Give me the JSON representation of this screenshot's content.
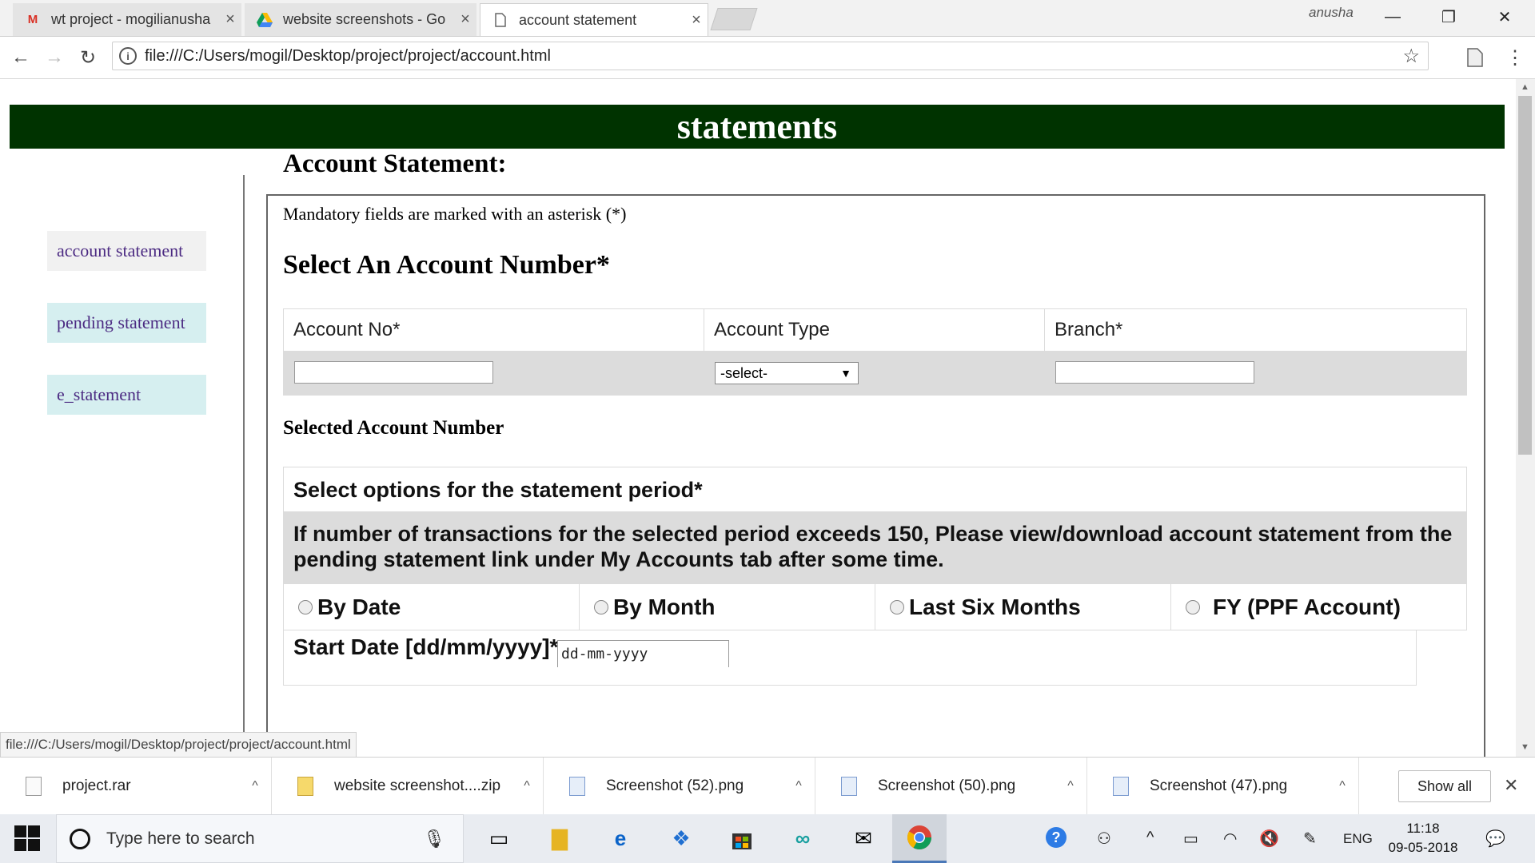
{
  "browser": {
    "tabs": [
      {
        "title": "wt project - mogilianusha",
        "icon": "gmail-icon"
      },
      {
        "title": "website screenshots - Go",
        "icon": "drive-icon"
      },
      {
        "title": "account statement",
        "icon": "document-icon"
      }
    ],
    "profile_name": "anusha",
    "url": "file:///C:/Users/mogil/Desktop/project/project/account.html",
    "status_url": "file:///C:/Users/mogil/Desktop/project/project/account.html"
  },
  "page": {
    "banner_title": "statements",
    "sidebar": [
      {
        "label": "account statement",
        "bg": "#f1f1f1"
      },
      {
        "label": "pending statement",
        "bg": "#d6eff0"
      },
      {
        "label": "e_statement",
        "bg": "#d6eff0"
      }
    ],
    "heading": "Account Statement:",
    "mandatory_note": "Mandatory fields are marked with an asterisk (*)",
    "select_heading": "Select An Account Number*",
    "account_table": {
      "headers": [
        "Account No*",
        "Account Type",
        "Branch*"
      ],
      "account_no_value": "",
      "account_type_selected": "-select-",
      "branch_value": ""
    },
    "selected_heading": "Selected Account Number",
    "period": {
      "heading": "Select options for the statement period*",
      "warning": "If number of transactions for the selected period exceeds 150, Please view/download account statement from the pending statement link under My Accounts tab after some time.",
      "options": [
        "By Date",
        "By Month",
        "Last Six Months",
        "FY (PPF Account)"
      ],
      "start_label": "Start Date [dd/mm/yyyy]*",
      "start_placeholder": "dd-mm-yyyy"
    }
  },
  "downloads": {
    "items": [
      {
        "name": "project.rar",
        "icon": "file-icon"
      },
      {
        "name": "website screenshot....zip",
        "icon": "zip-icon"
      },
      {
        "name": "Screenshot (52).png",
        "icon": "image-icon"
      },
      {
        "name": "Screenshot (50).png",
        "icon": "image-icon"
      },
      {
        "name": "Screenshot (47).png",
        "icon": "image-icon"
      }
    ],
    "show_all_label": "Show all"
  },
  "taskbar": {
    "search_placeholder": "Type here to search",
    "language": "ENG",
    "time": "11:18",
    "date": "09-05-2018"
  },
  "colors": {
    "banner_bg": "#003300",
    "link": "#4b2a82",
    "table_row_bg": "#dcdcdc"
  }
}
